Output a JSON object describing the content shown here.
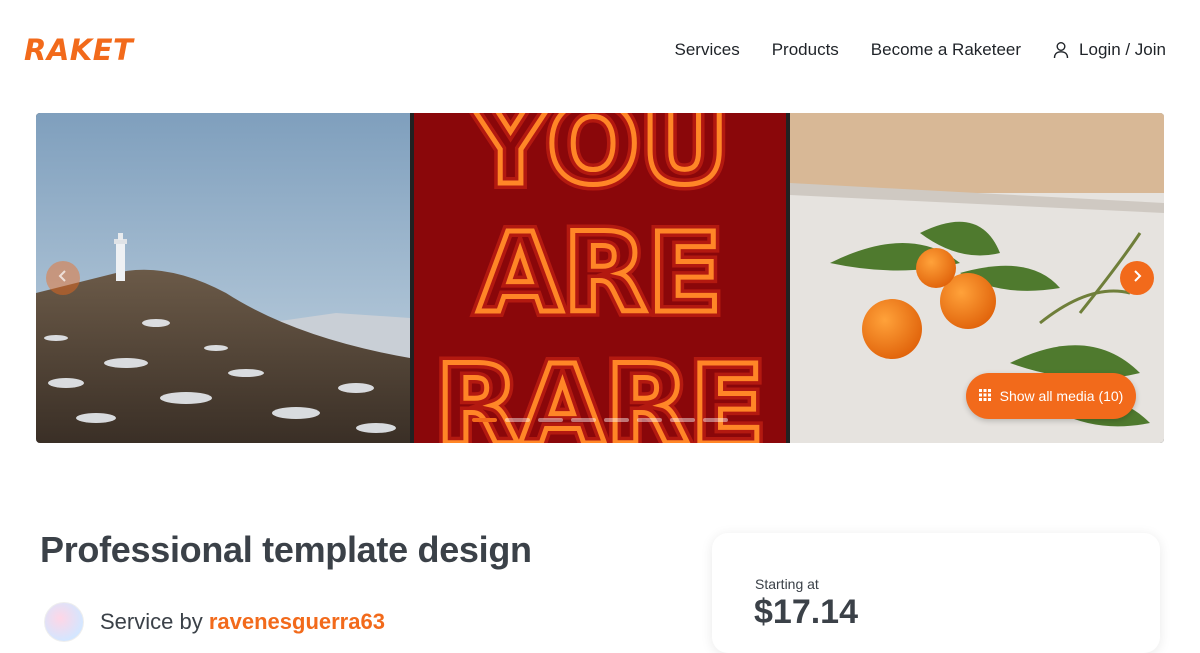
{
  "brand": {
    "logo": "RAKET",
    "accent_color": "#f26a1b"
  },
  "nav": {
    "items": [
      {
        "label": "Services"
      },
      {
        "label": "Products"
      },
      {
        "label": "Become a Raketeer"
      }
    ],
    "login_label": "Login / Join",
    "login_icon": "user-icon"
  },
  "gallery": {
    "images": [
      {
        "subject": "lighthouse-hill-landscape"
      },
      {
        "subject": "neon-sign",
        "sign_text": "YOU ARE RARE"
      },
      {
        "subject": "mandarin-oranges-with-leaves"
      }
    ],
    "slide_count": 8,
    "active_slide": 1,
    "show_all_label": "Show all media (10)",
    "prev_icon": "chevron-left-icon",
    "next_icon": "chevron-right-icon",
    "grid_icon": "grid-icon"
  },
  "service": {
    "title": "Professional template design",
    "seller_prefix": "Service by ",
    "seller_name": "ravenesguerra63"
  },
  "pricing": {
    "label": "Starting at",
    "price": "$17.14"
  }
}
